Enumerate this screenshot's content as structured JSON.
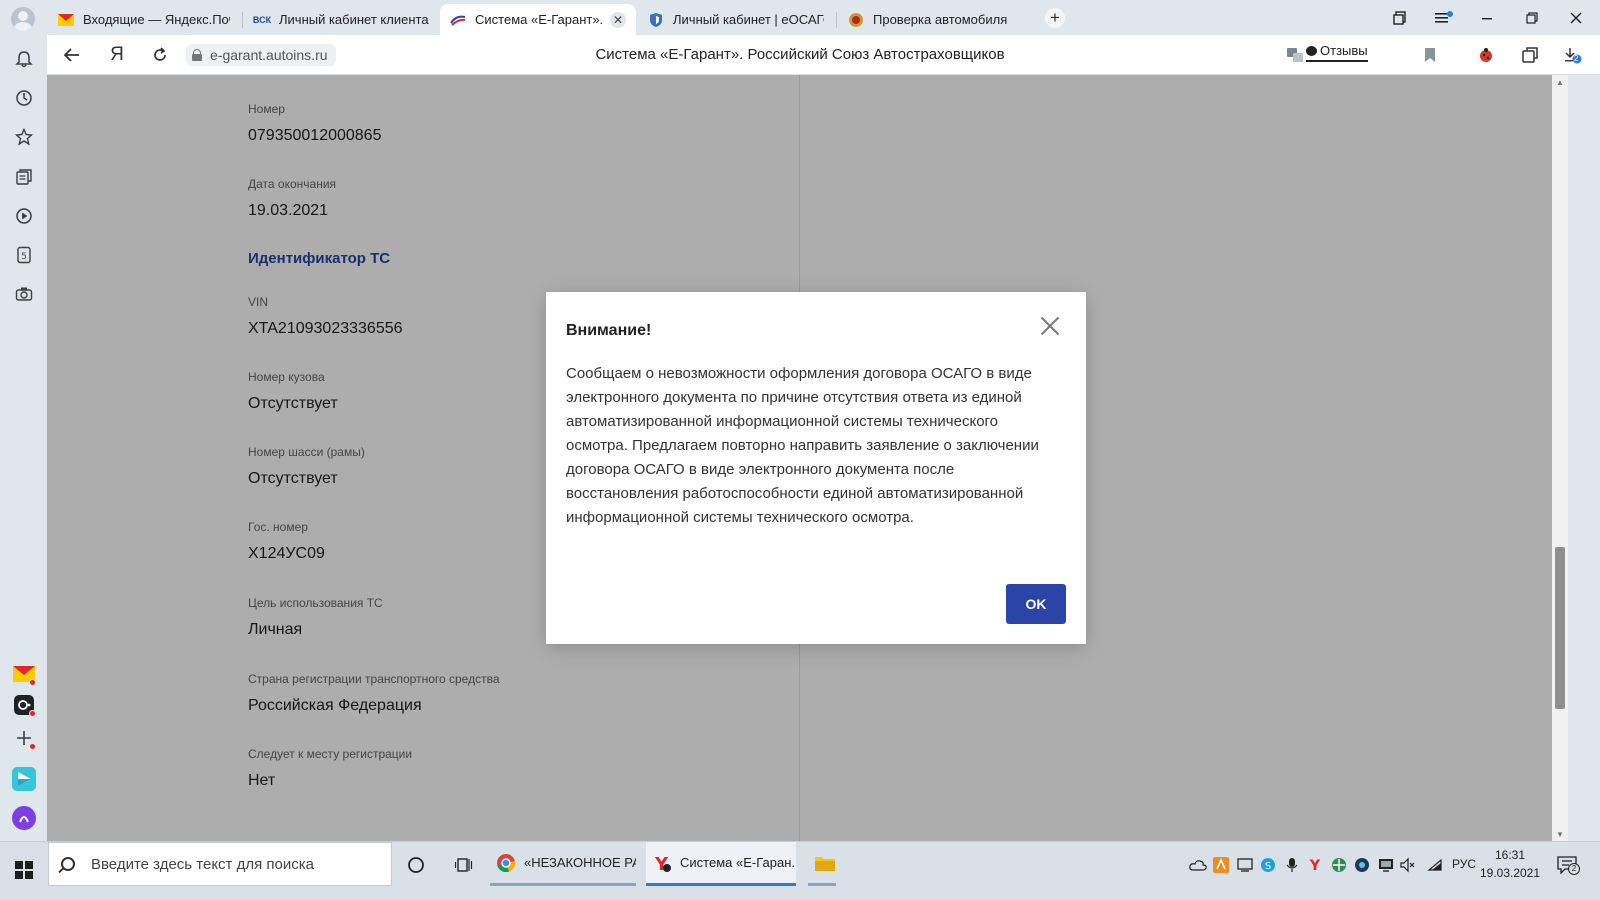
{
  "tabs": [
    {
      "title": "Входящие — Яндекс.Почта",
      "favicon": "mail-icon",
      "active": false
    },
    {
      "title": "Личный кабинет клиента",
      "favicon": "vsk-logo",
      "favicon_text": "ВСК",
      "active": false
    },
    {
      "title": "Система «Е-Гарант». Российский Союз Автостраховщиков",
      "favicon": "rsa-logo",
      "active": true
    },
    {
      "title": "Личный кабинет | еОСАГО",
      "favicon": "shield-icon",
      "active": false
    },
    {
      "title": "Проверка автомобиля",
      "favicon": "gibdd-emblem",
      "active": false
    }
  ],
  "address_bar": {
    "url": "e-garant.autoins.ru",
    "page_title": "Система «Е-Гарант». Российский Союз Автостраховщиков",
    "reviews_label": "Отзывы",
    "yandex_button": "Я",
    "downloads_count": "2"
  },
  "page": {
    "fields_top": [
      {
        "label": "Номер",
        "value": "079350012000865"
      },
      {
        "label": "Дата окончания",
        "value": "19.03.2021"
      }
    ],
    "section_title": "Идентификатор ТС",
    "fields": [
      {
        "label": "VIN",
        "value": "XTA21093023336556"
      },
      {
        "label": "Номер кузова",
        "value": "Отсутствует"
      },
      {
        "label": "Номер шасси (рамы)",
        "value": "Отсутствует"
      },
      {
        "label": "Гос. номер",
        "value": "Х124УС09"
      },
      {
        "label": "Цель использования ТС",
        "value": "Личная"
      },
      {
        "label": "Страна регистрации транспортного средства",
        "value": "Российская Федерация"
      },
      {
        "label": "Следует к месту регистрации",
        "value": "Нет"
      }
    ]
  },
  "modal": {
    "title": "Внимание!",
    "message": "Сообщаем о невозможности оформления договора ОСАГО в виде электронного документа по причине отсутствия ответа из единой автоматизированной информационной системы технического осмотра. Предлагаем повторно направить заявление о заключении договора ОСАГО в виде электронного документа после восстановления работоспособности единой автоматизированной информационной системы технического осмотра.",
    "ok_label": "OK"
  },
  "taskbar": {
    "search_placeholder": "Введите здесь текст для поиска",
    "apps": [
      {
        "label": "«НЕЗАКОННОЕ РА...",
        "icon": "chrome-icon"
      },
      {
        "label": "Система «Е-Гаран...",
        "icon": "yandex-browser-icon"
      }
    ],
    "language": "РУС",
    "time": "16:31",
    "date": "19.03.2021",
    "notification_count": "2"
  },
  "colors": {
    "accent_blue": "#2a44a8",
    "section_title": "#2547a3",
    "overlay": "rgba(0,0,0,0.32)"
  }
}
